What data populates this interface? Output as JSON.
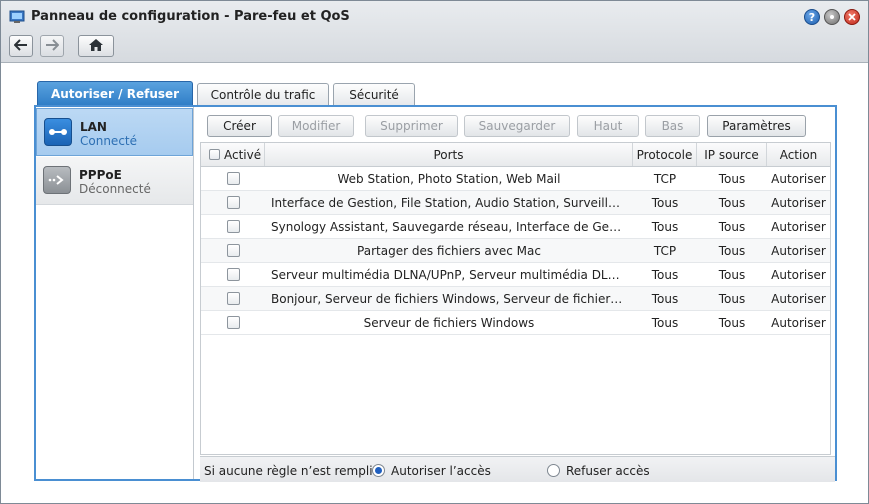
{
  "window": {
    "title": "Panneau de configuration - Pare-feu et QoS"
  },
  "window_controls": [
    "help-icon",
    "minimize-icon",
    "close-icon"
  ],
  "nav": {
    "icons": [
      "arrow-left-icon",
      "arrow-right-icon",
      "home-icon"
    ]
  },
  "tabs": [
    {
      "label": "Autoriser / Refuser",
      "active": true
    },
    {
      "label": "Contrôle du trafic",
      "active": false
    },
    {
      "label": "Sécurité",
      "active": false
    }
  ],
  "sidebar": {
    "items": [
      {
        "name": "LAN",
        "status": "Connecté",
        "selected": true,
        "icon": "lan-link-icon"
      },
      {
        "name": "PPPoE",
        "status": "Déconnecté",
        "selected": false,
        "icon": "pppoe-arrow-icon"
      }
    ]
  },
  "toolbar": {
    "create": "Créer",
    "modify": "Modifier",
    "delete": "Supprimer",
    "save": "Sauvegarder",
    "up": "Haut",
    "down": "Bas",
    "settings": "Paramètres"
  },
  "table": {
    "columns": [
      "Activé",
      "Ports",
      "Protocole",
      "IP source",
      "Action"
    ],
    "rows": [
      {
        "ports": "Web Station, Photo Station, Web Mail",
        "protocol": "TCP",
        "source": "Tous",
        "action": "Autoriser"
      },
      {
        "ports": "Interface de Gestion, File Station, Audio Station, Surveillance ...",
        "protocol": "Tous",
        "source": "Tous",
        "action": "Autoriser"
      },
      {
        "ports": "Synology Assistant, Sauvegarde réseau, Interface de Gestion, ...",
        "protocol": "Tous",
        "source": "Tous",
        "action": "Autoriser"
      },
      {
        "ports": "Partager des fichiers avec Mac",
        "protocol": "TCP",
        "source": "Tous",
        "action": "Autoriser"
      },
      {
        "ports": "Serveur multimédia DLNA/UPnP, Serveur multimédia DLNA/UP...",
        "protocol": "Tous",
        "source": "Tous",
        "action": "Autoriser"
      },
      {
        "ports": "Bonjour, Serveur de fichiers Windows, Serveur de fichiers Linu...",
        "protocol": "Tous",
        "source": "Tous",
        "action": "Autoriser"
      },
      {
        "ports": "Serveur de fichiers Windows",
        "protocol": "Tous",
        "source": "Tous",
        "action": "Autoriser"
      }
    ]
  },
  "footer": {
    "label": "Si aucune règle n’est remplie:",
    "allow": "Autoriser l’accès",
    "deny": "Refuser accès",
    "selected": "allow"
  },
  "colors": {
    "accent": "#2e7dc6",
    "selection": "#a6cbef"
  }
}
